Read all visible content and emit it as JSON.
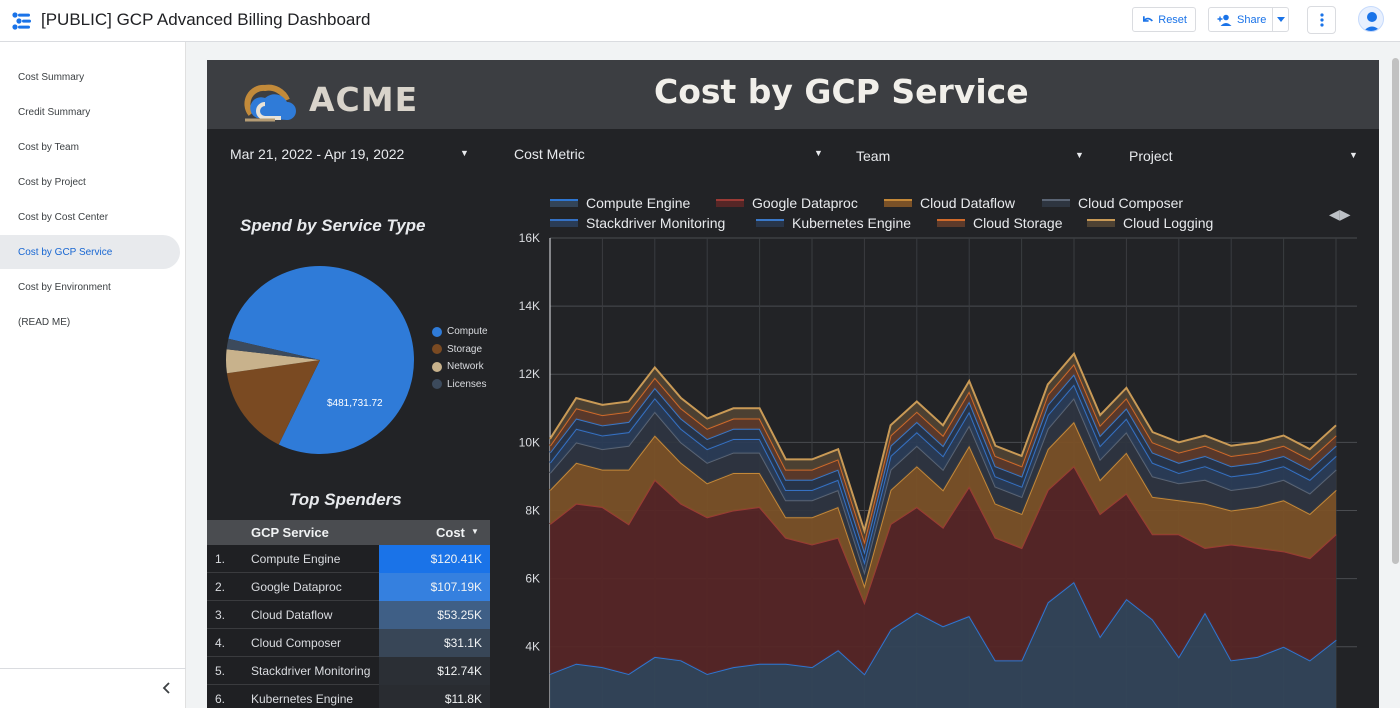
{
  "app": {
    "title": "[PUBLIC] GCP Advanced Billing Dashboard",
    "reset_label": "Reset",
    "share_label": "Share"
  },
  "sidebar": {
    "items": [
      {
        "label": "Cost Summary",
        "active": false
      },
      {
        "label": "Credit Summary",
        "active": false
      },
      {
        "label": "Cost by Team",
        "active": false
      },
      {
        "label": "Cost by Project",
        "active": false
      },
      {
        "label": "Cost by Cost Center",
        "active": false
      },
      {
        "label": "Cost by GCP Service",
        "active": true
      },
      {
        "label": "Cost by Environment",
        "active": false
      },
      {
        "label": "(READ ME)",
        "active": false
      }
    ],
    "collapse_icon": "chevron-left-icon"
  },
  "report": {
    "logo_text": "ACME",
    "title": "Cost by GCP Service",
    "filters": {
      "date_range": "Mar 21, 2022 - Apr 19, 2022",
      "metric": "Cost Metric",
      "team": "Team",
      "project": "Project"
    },
    "pie_title": "Spend by Service Type",
    "table_title": "Top Spenders",
    "table": {
      "col_service": "GCP Service",
      "col_cost": "Cost",
      "rows": [
        {
          "rank": "1.",
          "service": "Compute Engine",
          "cost": "$120.41K",
          "color": "#1a73e8"
        },
        {
          "rank": "2.",
          "service": "Google Dataproc",
          "cost": "$107.19K",
          "color": "#3580df"
        },
        {
          "rank": "3.",
          "service": "Cloud Dataflow",
          "cost": "$53.25K",
          "color": "#3f5f86"
        },
        {
          "rank": "4.",
          "service": "Cloud Composer",
          "cost": "$31.1K",
          "color": "#384657"
        },
        {
          "rank": "5.",
          "service": "Stackdriver Monitoring",
          "cost": "$12.74K",
          "color": "#2b2f35"
        },
        {
          "rank": "6.",
          "service": "Kubernetes Engine",
          "cost": "$11.8K",
          "color": "#292c31"
        }
      ]
    }
  },
  "chart_data": [
    {
      "type": "pie",
      "title": "Spend by Service Type",
      "legend_position": "right",
      "slices": [
        {
          "label": "Compute",
          "value": 481731.72,
          "color": "#2f7bd8"
        },
        {
          "label": "Storage",
          "value": 95000,
          "color": "#7a4a22"
        },
        {
          "label": "Network",
          "value": 25000,
          "color": "#c8b28c"
        },
        {
          "label": "Licenses",
          "value": 11000,
          "color": "#3c4a5c"
        }
      ],
      "data_label": "$481,731.72"
    },
    {
      "type": "area",
      "stacked": true,
      "ylim": [
        0,
        16000
      ],
      "yticks": [
        "4K",
        "6K",
        "8K",
        "10K",
        "12K",
        "14K",
        "16K"
      ],
      "grid": true,
      "legend_position": "top",
      "series": [
        {
          "name": "Compute Engine",
          "color": "#2e76d2",
          "fill": "#334458",
          "values": [
            3200,
            3500,
            3400,
            3200,
            3700,
            3600,
            3200,
            3400,
            3500,
            3500,
            3400,
            3900,
            3200,
            4500,
            5000,
            4600,
            4900,
            3600,
            3600,
            5300,
            5900,
            4300,
            5400,
            4800,
            3700,
            5000,
            3600,
            3700,
            4000,
            3600,
            4200
          ]
        },
        {
          "name": "Google Dataproc",
          "color": "#9b3a35",
          "fill": "#562626",
          "values": [
            4400,
            4700,
            4700,
            4400,
            5200,
            4600,
            4600,
            4600,
            4600,
            3700,
            3600,
            3300,
            2100,
            3100,
            3100,
            2900,
            3800,
            3600,
            3300,
            3300,
            3400,
            3600,
            3100,
            2500,
            3600,
            1900,
            3400,
            3200,
            2800,
            3000,
            3100
          ]
        },
        {
          "name": "Cloud Dataflow",
          "color": "#c48838",
          "fill": "#7a5127",
          "values": [
            1000,
            1200,
            1100,
            1600,
            1300,
            1200,
            1000,
            1100,
            1000,
            600,
            800,
            900,
            500,
            1000,
            1200,
            1100,
            1200,
            1000,
            1000,
            1200,
            1300,
            1000,
            1200,
            1100,
            1000,
            1300,
            1000,
            1200,
            1500,
            1300,
            1300
          ]
        },
        {
          "name": "Cloud Composer",
          "color": "#5a6474",
          "fill": "#2e3540",
          "values": [
            500,
            600,
            600,
            700,
            700,
            600,
            600,
            600,
            600,
            500,
            500,
            500,
            400,
            600,
            600,
            600,
            600,
            500,
            500,
            600,
            700,
            600,
            600,
            600,
            500,
            700,
            600,
            600,
            600,
            600,
            600
          ]
        },
        {
          "name": "Stackdriver Monitoring",
          "color": "#3571c4",
          "fill": "#2a3c56",
          "values": [
            300,
            400,
            400,
            400,
            400,
            400,
            400,
            400,
            400,
            300,
            300,
            300,
            300,
            400,
            400,
            400,
            400,
            300,
            300,
            400,
            400,
            400,
            400,
            400,
            300,
            400,
            400,
            400,
            400,
            400,
            400
          ]
        },
        {
          "name": "Kubernetes Engine",
          "color": "#3a78c8",
          "fill": "#283549",
          "values": [
            300,
            300,
            300,
            300,
            300,
            300,
            300,
            300,
            300,
            300,
            300,
            300,
            300,
            300,
            300,
            300,
            300,
            300,
            300,
            300,
            300,
            300,
            300,
            300,
            300,
            300,
            300,
            300,
            300,
            300,
            300
          ]
        },
        {
          "name": "Cloud Storage",
          "color": "#d06a2a",
          "fill": "#5d3a2a",
          "values": [
            200,
            300,
            300,
            300,
            300,
            300,
            300,
            300,
            300,
            300,
            300,
            300,
            300,
            300,
            300,
            300,
            300,
            300,
            300,
            300,
            300,
            300,
            300,
            300,
            300,
            300,
            300,
            300,
            300,
            300,
            300
          ]
        },
        {
          "name": "Cloud Logging",
          "color": "#c99a56",
          "fill": "#4e4233",
          "values": [
            200,
            300,
            300,
            300,
            300,
            300,
            300,
            300,
            300,
            300,
            300,
            300,
            300,
            300,
            300,
            300,
            300,
            300,
            300,
            300,
            300,
            300,
            300,
            300,
            300,
            300,
            300,
            300,
            300,
            300,
            300
          ]
        }
      ]
    }
  ]
}
